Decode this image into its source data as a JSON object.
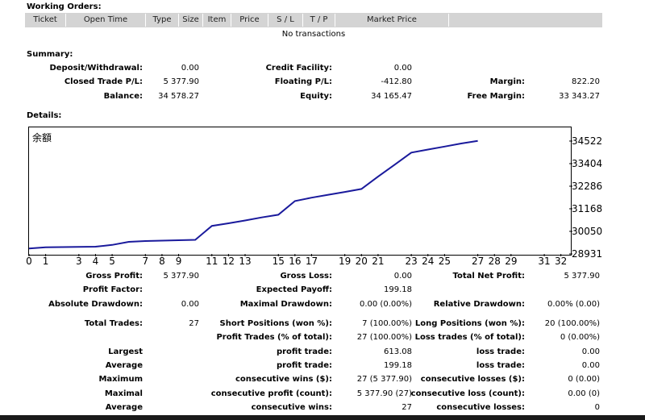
{
  "working_orders": {
    "title": "Working Orders:",
    "columns": [
      "Ticket",
      "Open Time",
      "Type",
      "Size",
      "Item",
      "Price",
      "S / L",
      "T / P",
      "Market Price"
    ],
    "empty_text": "No transactions"
  },
  "summary": {
    "title": "Summary:",
    "deposit_label": "Deposit/Withdrawal:",
    "deposit_value": "0.00",
    "credit_label": "Credit Facility:",
    "credit_value": "0.00",
    "closed_pl_label": "Closed Trade P/L:",
    "closed_pl_value": "5 377.90",
    "floating_pl_label": "Floating P/L:",
    "floating_pl_value": "-412.80",
    "margin_label": "Margin:",
    "margin_value": "822.20",
    "balance_label": "Balance:",
    "balance_value": "34 578.27",
    "equity_label": "Equity:",
    "equity_value": "34 165.47",
    "free_margin_label": "Free Margin:",
    "free_margin_value": "33 343.27"
  },
  "details": {
    "title": "Details:"
  },
  "chart_data": {
    "type": "line",
    "title": "余額",
    "x": [
      0,
      1,
      2,
      3,
      4,
      5,
      6,
      7,
      8,
      9,
      10,
      11,
      12,
      13,
      14,
      15,
      16,
      17,
      18,
      19,
      20,
      21,
      22,
      23,
      24,
      25,
      26,
      27
    ],
    "series": [
      {
        "values": [
          29200,
          29260,
          29270,
          29280,
          29290,
          29380,
          29530,
          29570,
          29590,
          29610,
          29630,
          30320,
          30450,
          30590,
          30740,
          30870,
          31550,
          31720,
          31860,
          32000,
          32150,
          32760,
          33350,
          33950,
          34100,
          34250,
          34400,
          34530
        ],
        "color": "#1a1a9c"
      }
    ],
    "x_ticks": [
      "0",
      "1",
      "3",
      "4",
      "5",
      "7",
      "8",
      "9",
      "11",
      "12",
      "13",
      "15",
      "16",
      "17",
      "19",
      "20",
      "21",
      "23",
      "24",
      "25",
      "27",
      "28",
      "29",
      "31",
      "32"
    ],
    "y_ticks": [
      "34522",
      "33404",
      "32286",
      "31168",
      "30050",
      "28931"
    ],
    "ylim": [
      28931,
      35200
    ]
  },
  "stats": {
    "gross_profit_label": "Gross Profit:",
    "gross_profit_value": "5 377.90",
    "gross_loss_label": "Gross Loss:",
    "gross_loss_value": "0.00",
    "total_net_profit_label": "Total Net Profit:",
    "total_net_profit_value": "5 377.90",
    "profit_factor_label": "Profit Factor:",
    "expected_payoff_label": "Expected Payoff:",
    "expected_payoff_value": "199.18",
    "absolute_dd_label": "Absolute Drawdown:",
    "absolute_dd_value": "0.00",
    "maximal_dd_label": "Maximal Drawdown:",
    "maximal_dd_value": "0.00 (0.00%)",
    "relative_dd_label": "Relative Drawdown:",
    "relative_dd_value": "0.00% (0.00)",
    "total_trades_label": "Total Trades:",
    "total_trades_value": "27",
    "short_pos_label": "Short Positions (won %):",
    "short_pos_value": "7 (100.00%)",
    "long_pos_label": "Long Positions (won %):",
    "long_pos_value": "20 (100.00%)",
    "profit_trades_label": "Profit Trades (% of total):",
    "profit_trades_value": "27 (100.00%)",
    "loss_trades_label": "Loss trades (% of total):",
    "loss_trades_value": "0 (0.00%)",
    "largest_label": "Largest",
    "largest_profit_label": "profit trade:",
    "largest_profit_value": "613.08",
    "largest_loss_label": "loss trade:",
    "largest_loss_value": "0.00",
    "average_label": "Average",
    "average_profit_label": "profit trade:",
    "average_profit_value": "199.18",
    "average_loss_label": "loss trade:",
    "average_loss_value": "0.00",
    "maximum_label": "Maximum",
    "max_cons_wins_label": "consecutive wins ($):",
    "max_cons_wins_value": "27 (5 377.90)",
    "max_cons_losses_label": "consecutive losses ($):",
    "max_cons_losses_value": "0 (0.00)",
    "maximal_label": "Maximal",
    "maximal_cons_profit_label": "consecutive profit (count):",
    "maximal_cons_profit_value": "5 377.90 (27)",
    "maximal_cons_loss_label": "consecutive loss (count):",
    "maximal_cons_loss_value": "0.00 (0)",
    "average2_label": "Average",
    "avg_cons_wins_label": "consecutive wins:",
    "avg_cons_wins_value": "27",
    "avg_cons_losses_label": "consecutive losses:",
    "avg_cons_losses_value": "0"
  }
}
